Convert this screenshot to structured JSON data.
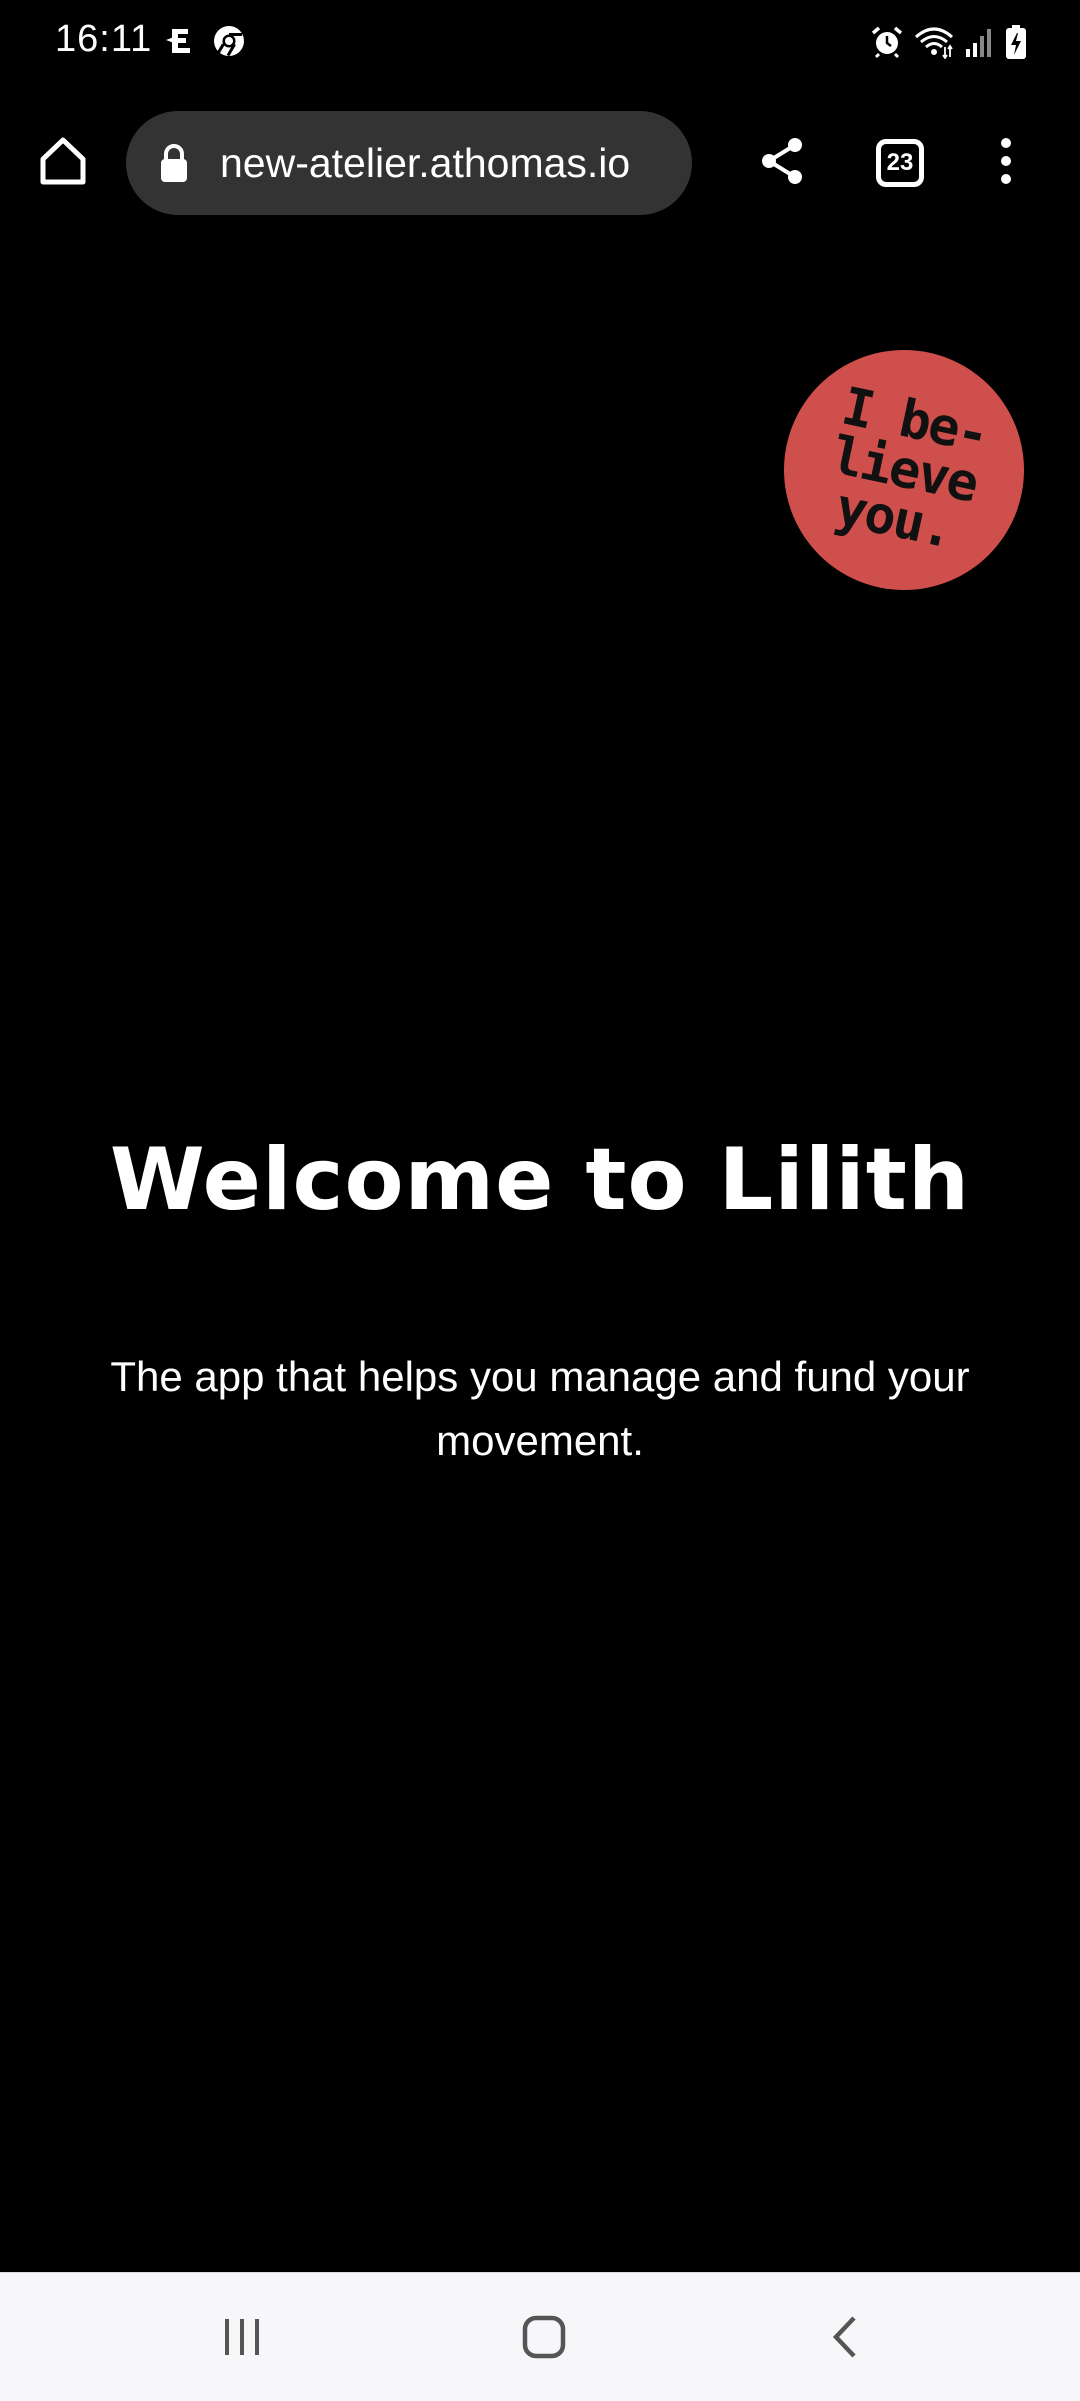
{
  "status_bar": {
    "time": "16:11",
    "left_icons": [
      "notification-icon",
      "chrome-icon"
    ],
    "right_icons": [
      "alarm-icon",
      "wifi-icon",
      "signal-icon",
      "battery-charging-icon"
    ]
  },
  "browser": {
    "url": "new-atelier.athomas.io",
    "tab_count": "23",
    "icons": {
      "home": "home-icon",
      "lock": "lock-icon",
      "share": "share-icon",
      "tabs": "tabs-icon",
      "menu": "more-vert-icon"
    }
  },
  "page": {
    "badge_text": "I be-\nlieve\nyou.",
    "badge_color": "#cf4f4c",
    "title": "Welcome to Lilith",
    "subtitle": "The app that helps you manage and fund your movement."
  },
  "nav_bar": {
    "icons": [
      "recent-apps-icon",
      "home-nav-icon",
      "back-icon"
    ]
  }
}
